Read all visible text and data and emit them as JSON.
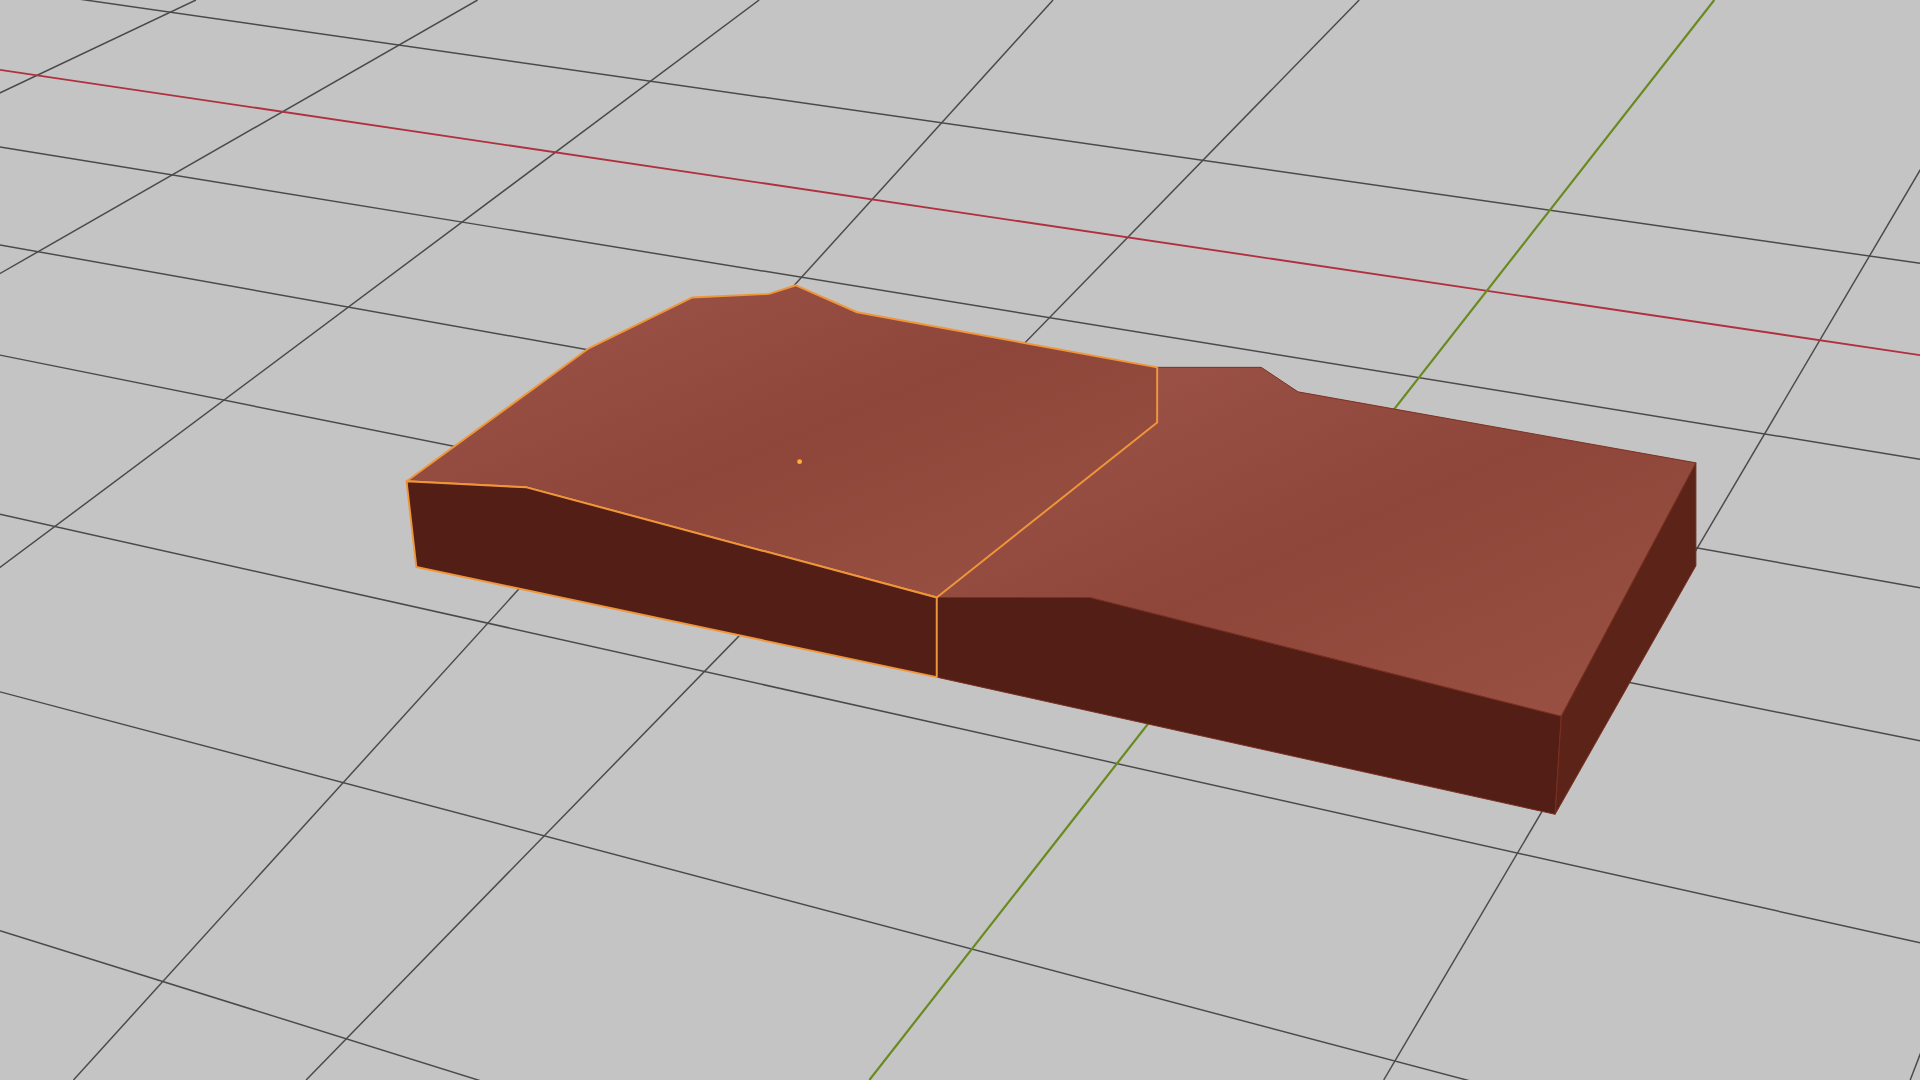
{
  "viewport": {
    "objects": [
      {
        "kind": "terrain",
        "selected": true
      },
      {
        "kind": "terrain",
        "selected": false
      }
    ]
  }
}
